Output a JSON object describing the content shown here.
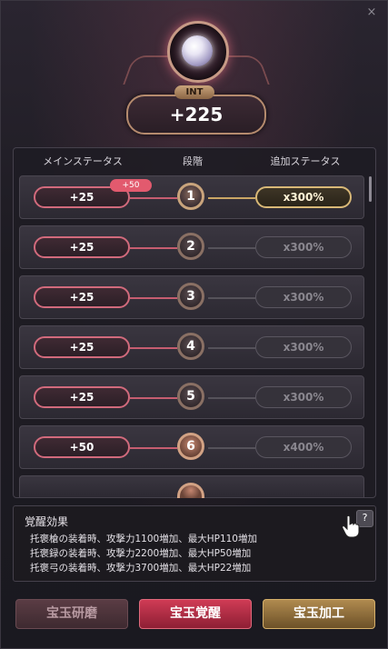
{
  "window": {
    "close_label": "×"
  },
  "stat": {
    "tag": "INT",
    "value": "+225"
  },
  "table": {
    "headers": {
      "main": "メインステータス",
      "stage": "段階",
      "bonus": "追加ステータス"
    },
    "bonus_badge": "+50",
    "rows": [
      {
        "main": "+25",
        "stage": "1",
        "bonus": "x300%"
      },
      {
        "main": "+25",
        "stage": "2",
        "bonus": "x300%"
      },
      {
        "main": "+25",
        "stage": "3",
        "bonus": "x300%"
      },
      {
        "main": "+25",
        "stage": "4",
        "bonus": "x300%"
      },
      {
        "main": "+25",
        "stage": "5",
        "bonus": "x300%"
      },
      {
        "main": "+50",
        "stage": "6",
        "bonus": "x400%"
      }
    ]
  },
  "effect": {
    "title": "覚醒効果",
    "help": "?",
    "lines": [
      "托褒槍の装着時、攻撃力1100増加、最大HP110増加",
      "托褒録の装着時、攻撃力2200増加、最大HP50増加",
      "托褒弓の装着時、攻撃力3700増加、最大HP22増加"
    ]
  },
  "buttons": {
    "polish": "宝玉研磨",
    "awaken": "宝玉覚醒",
    "process": "宝玉加工"
  },
  "colors": {
    "accent_pink": "#d16a7c",
    "accent_gold": "#d8b877",
    "awaken_red": "#cf3b55"
  }
}
